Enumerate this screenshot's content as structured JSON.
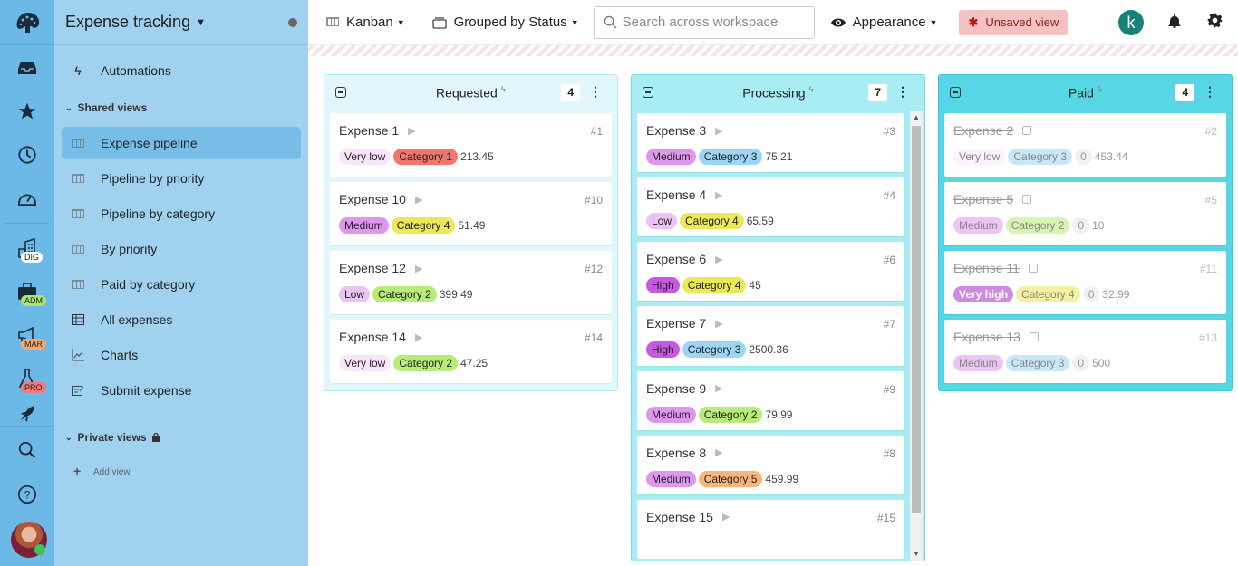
{
  "rail": {
    "badges": [
      {
        "label": "DIG",
        "color": "#ffffff"
      },
      {
        "label": "ADM",
        "color": "#a8e66a"
      },
      {
        "label": "MAR",
        "color": "#f6a96b"
      },
      {
        "label": "PRO",
        "color": "#f07a7a"
      }
    ]
  },
  "sidebar": {
    "title": "Expense tracking",
    "automations": "Automations",
    "shared_views_label": "Shared views",
    "shared_views": [
      {
        "label": "Expense pipeline",
        "icon": "kanban-icon",
        "active": true
      },
      {
        "label": "Pipeline by priority",
        "icon": "kanban-icon"
      },
      {
        "label": "Pipeline by category",
        "icon": "kanban-icon"
      },
      {
        "label": "By priority",
        "icon": "kanban-icon"
      },
      {
        "label": "Paid by category",
        "icon": "kanban-icon"
      },
      {
        "label": "All expenses",
        "icon": "table-icon"
      },
      {
        "label": "Charts",
        "icon": "chart-icon"
      },
      {
        "label": "Submit expense",
        "icon": "form-icon"
      }
    ],
    "private_views_label": "Private views",
    "add_view": "Add view"
  },
  "toolbar": {
    "view_type": "Kanban",
    "grouping": "Grouped by Status",
    "search_placeholder": "Search across workspace",
    "appearance": "Appearance",
    "unsaved": "Unsaved view",
    "user_initial": "k"
  },
  "columns": [
    {
      "title": "Requested",
      "count": "4",
      "cards": [
        {
          "title": "Expense 1",
          "id": "#1",
          "priority": "Very low",
          "priority_color": "#fae6fb",
          "category": "Category 1",
          "category_color": "#f0776e",
          "amount": "213.45"
        },
        {
          "title": "Expense 10",
          "id": "#10",
          "priority": "Medium",
          "priority_color": "#df96ec",
          "category": "Category 4",
          "category_color": "#ece957",
          "amount": "51.49"
        },
        {
          "title": "Expense 12",
          "id": "#12",
          "priority": "Low",
          "priority_color": "#eac4f5",
          "category": "Category 2",
          "category_color": "#b6ec77",
          "amount": "399.49"
        },
        {
          "title": "Expense 14",
          "id": "#14",
          "priority": "Very low",
          "priority_color": "#fae6fb",
          "category": "Category 2",
          "category_color": "#b6ec77",
          "amount": "47.25"
        }
      ]
    },
    {
      "title": "Processing",
      "count": "7",
      "cards": [
        {
          "title": "Expense 3",
          "id": "#3",
          "priority": "Medium",
          "priority_color": "#df96ec",
          "category": "Category 3",
          "category_color": "#9cd6f7",
          "amount": "75.21"
        },
        {
          "title": "Expense 4",
          "id": "#4",
          "priority": "Low",
          "priority_color": "#eac4f5",
          "category": "Category 4",
          "category_color": "#ece957",
          "amount": "65.59"
        },
        {
          "title": "Expense 6",
          "id": "#6",
          "priority": "High",
          "priority_color": "#c758e2",
          "category": "Category 4",
          "category_color": "#ece957",
          "amount": "45"
        },
        {
          "title": "Expense 7",
          "id": "#7",
          "priority": "High",
          "priority_color": "#c758e2",
          "category": "Category 3",
          "category_color": "#9cd6f7",
          "amount": "2500.36"
        },
        {
          "title": "Expense 9",
          "id": "#9",
          "priority": "Medium",
          "priority_color": "#df96ec",
          "category": "Category 2",
          "category_color": "#b6ec77",
          "amount": "79.99"
        },
        {
          "title": "Expense 8",
          "id": "#8",
          "priority": "Medium",
          "priority_color": "#df96ec",
          "category": "Category 5",
          "category_color": "#f8b57a",
          "amount": "459.99"
        },
        {
          "title": "Expense 15",
          "id": "#15",
          "priority": "",
          "priority_color": "",
          "category": "",
          "category_color": "",
          "amount": ""
        }
      ]
    },
    {
      "title": "Paid",
      "count": "4",
      "cards": [
        {
          "title": "Expense 2",
          "id": "#2",
          "priority": "Very low",
          "priority_color": "#fae6fb",
          "category": "Category 3",
          "category_color": "#9cd6f7",
          "zero": "0",
          "amount": "453.44"
        },
        {
          "title": "Expense 5",
          "id": "#5",
          "priority": "Medium",
          "priority_color": "#df96ec",
          "category": "Category 2",
          "category_color": "#b6ec77",
          "zero": "0",
          "amount": "10"
        },
        {
          "title": "Expense 11",
          "id": "#11",
          "priority": "Very high",
          "priority_color": "#a52fc8",
          "priority_text_color": "#ffffff",
          "category": "Category 4",
          "category_color": "#ece957",
          "zero": "0",
          "amount": "32.99"
        },
        {
          "title": "Expense 13",
          "id": "#13",
          "priority": "Medium",
          "priority_color": "#df96ec",
          "category": "Category 3",
          "category_color": "#9cd6f7",
          "zero": "0",
          "amount": "500"
        }
      ]
    }
  ]
}
